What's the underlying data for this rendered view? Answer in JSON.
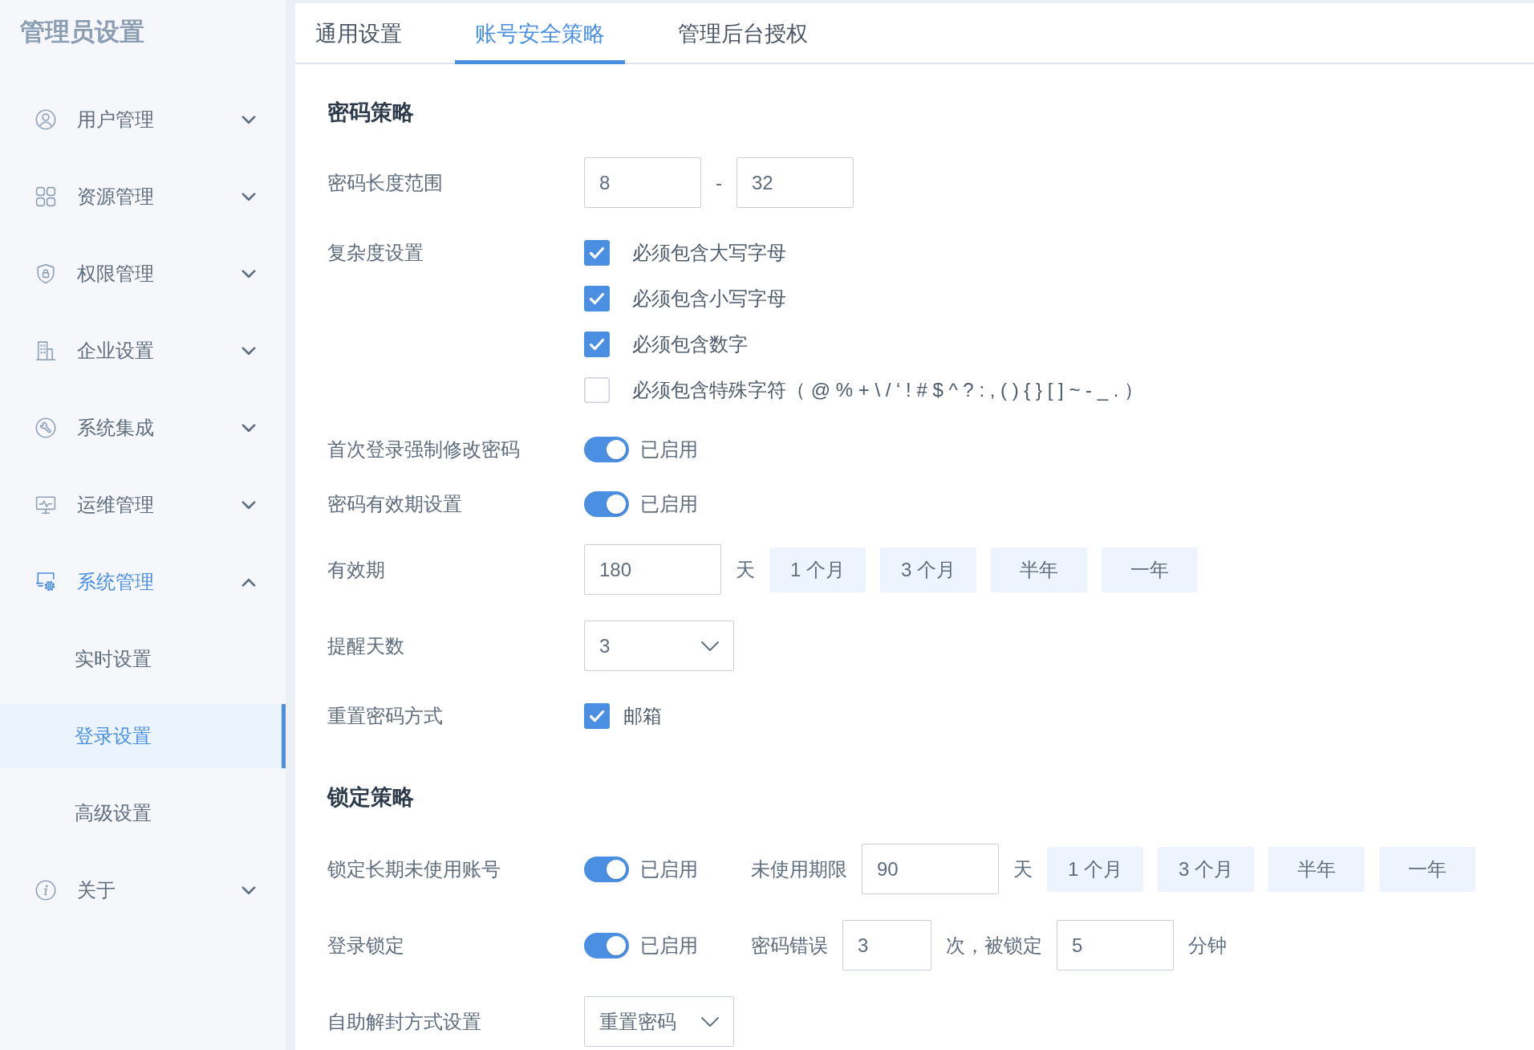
{
  "sidebar": {
    "title": "管理员设置",
    "items": [
      {
        "label": "用户管理",
        "selected": false,
        "expanded": false
      },
      {
        "label": "资源管理",
        "selected": false,
        "expanded": false
      },
      {
        "label": "权限管理",
        "selected": false,
        "expanded": false
      },
      {
        "label": "企业设置",
        "selected": false,
        "expanded": false
      },
      {
        "label": "系统集成",
        "selected": false,
        "expanded": false
      },
      {
        "label": "运维管理",
        "selected": false,
        "expanded": false
      },
      {
        "label": "系统管理",
        "selected": true,
        "expanded": true,
        "children": [
          {
            "label": "实时设置",
            "selected": false
          },
          {
            "label": "登录设置",
            "selected": true
          },
          {
            "label": "高级设置",
            "selected": false
          }
        ]
      },
      {
        "label": "关于",
        "selected": false,
        "expanded": false
      }
    ]
  },
  "tabs": [
    {
      "label": "通用设置",
      "selected": false
    },
    {
      "label": "账号安全策略",
      "selected": true
    },
    {
      "label": "管理后台授权",
      "selected": false
    }
  ],
  "sections": [
    {
      "title": "密码策略",
      "rows": [
        {
          "label": "密码长度范围",
          "controls": [
            {
              "kind": "input",
              "value": "8"
            },
            {
              "kind": "text",
              "text": "-"
            },
            {
              "kind": "input",
              "value": "32"
            }
          ]
        },
        {
          "label": "复杂度设置",
          "controls": [
            {
              "kind": "checklist",
              "options": [
                {
                  "label": "必须包含大写字母",
                  "checked": true
                },
                {
                  "label": "必须包含小写字母",
                  "checked": true
                },
                {
                  "label": "必须包含数字",
                  "checked": true
                },
                {
                  "label": "必须包含特殊字符（ @ % + \\ / ‘ ! # $ ^ ? : , ( ) { } [ ] ~ - _ . ）",
                  "checked": false
                }
              ]
            }
          ]
        },
        {
          "label": "首次登录强制修改密码",
          "controls": [
            {
              "kind": "toggle",
              "on": true,
              "status": "已启用"
            }
          ]
        },
        {
          "label": "密码有效期设置",
          "controls": [
            {
              "kind": "toggle",
              "on": true,
              "status": "已启用"
            }
          ]
        },
        {
          "label": "有效期",
          "controls": [
            {
              "kind": "input",
              "value": "180"
            },
            {
              "kind": "text",
              "text": "天"
            },
            {
              "kind": "button",
              "label": "1 个月"
            },
            {
              "kind": "button",
              "label": "3 个月"
            },
            {
              "kind": "button",
              "label": "半年"
            },
            {
              "kind": "button",
              "label": "一年"
            }
          ]
        },
        {
          "label": "提醒天数",
          "controls": [
            {
              "kind": "select",
              "value": "3"
            }
          ]
        },
        {
          "label": "重置密码方式",
          "controls": [
            {
              "kind": "checkbox",
              "label": "邮箱",
              "checked": true
            }
          ]
        }
      ]
    },
    {
      "title": "锁定策略",
      "rows": [
        {
          "label": "锁定长期未使用账号",
          "controls": [
            {
              "kind": "toggle",
              "on": true,
              "status": "已启用"
            },
            {
              "kind": "text",
              "text": "未使用期限"
            },
            {
              "kind": "input",
              "value": "90"
            },
            {
              "kind": "text",
              "text": "天"
            },
            {
              "kind": "button",
              "label": "1 个月"
            },
            {
              "kind": "button",
              "label": "3 个月"
            },
            {
              "kind": "button",
              "label": "半年"
            },
            {
              "kind": "button",
              "label": "一年"
            }
          ]
        },
        {
          "label": "登录锁定",
          "controls": [
            {
              "kind": "toggle",
              "on": true,
              "status": "已启用"
            },
            {
              "kind": "text",
              "text": "密码错误"
            },
            {
              "kind": "input",
              "value": "3"
            },
            {
              "kind": "text",
              "text": "次，被锁定"
            },
            {
              "kind": "input",
              "value": "5"
            },
            {
              "kind": "text",
              "text": "分钟"
            }
          ]
        },
        {
          "label": "自助解封方式设置",
          "controls": [
            {
              "kind": "select",
              "value": "重置密码"
            }
          ]
        }
      ]
    }
  ]
}
